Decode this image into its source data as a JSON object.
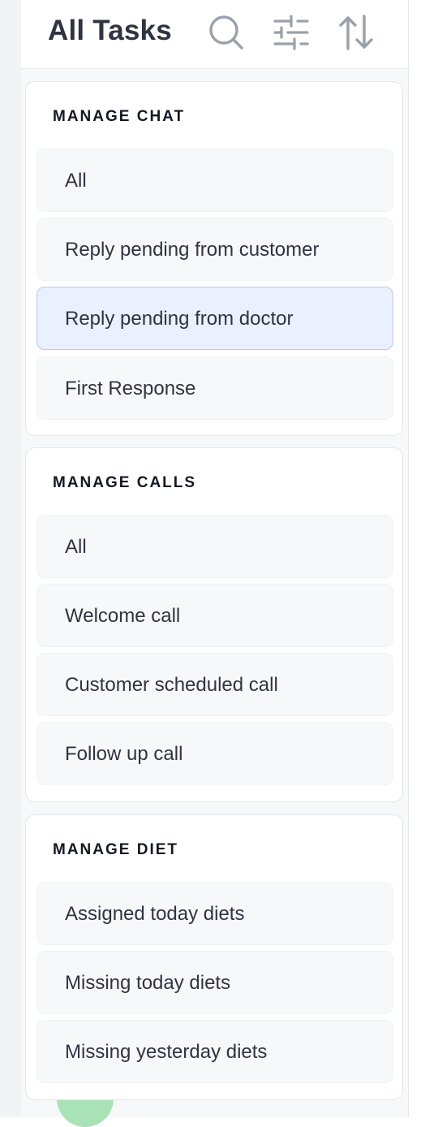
{
  "header": {
    "title": "All Tasks",
    "icons": [
      "search-icon",
      "filter-sliders-icon",
      "sort-icon"
    ]
  },
  "colors": {
    "selected_bg": "#eaf0fd",
    "selected_border": "#b9c8ee",
    "item_bg": "#f7f8fa",
    "title_text": "#2f3441",
    "avatar": "#a9e2b6"
  },
  "sections": [
    {
      "title": "MANAGE CHAT",
      "items": [
        {
          "label": "All",
          "selected": false
        },
        {
          "label": "Reply pending from customer",
          "selected": false
        },
        {
          "label": "Reply pending from doctor",
          "selected": true
        },
        {
          "label": "First Response",
          "selected": false
        }
      ]
    },
    {
      "title": "MANAGE CALLS",
      "items": [
        {
          "label": "All",
          "selected": false
        },
        {
          "label": "Welcome call",
          "selected": false
        },
        {
          "label": "Customer scheduled call",
          "selected": false
        },
        {
          "label": "Follow up call",
          "selected": false
        }
      ]
    },
    {
      "title": "MANAGE DIET",
      "items": [
        {
          "label": "Assigned today diets",
          "selected": false
        },
        {
          "label": "Missing today diets",
          "selected": false
        },
        {
          "label": "Missing yesterday diets",
          "selected": false
        }
      ]
    }
  ]
}
